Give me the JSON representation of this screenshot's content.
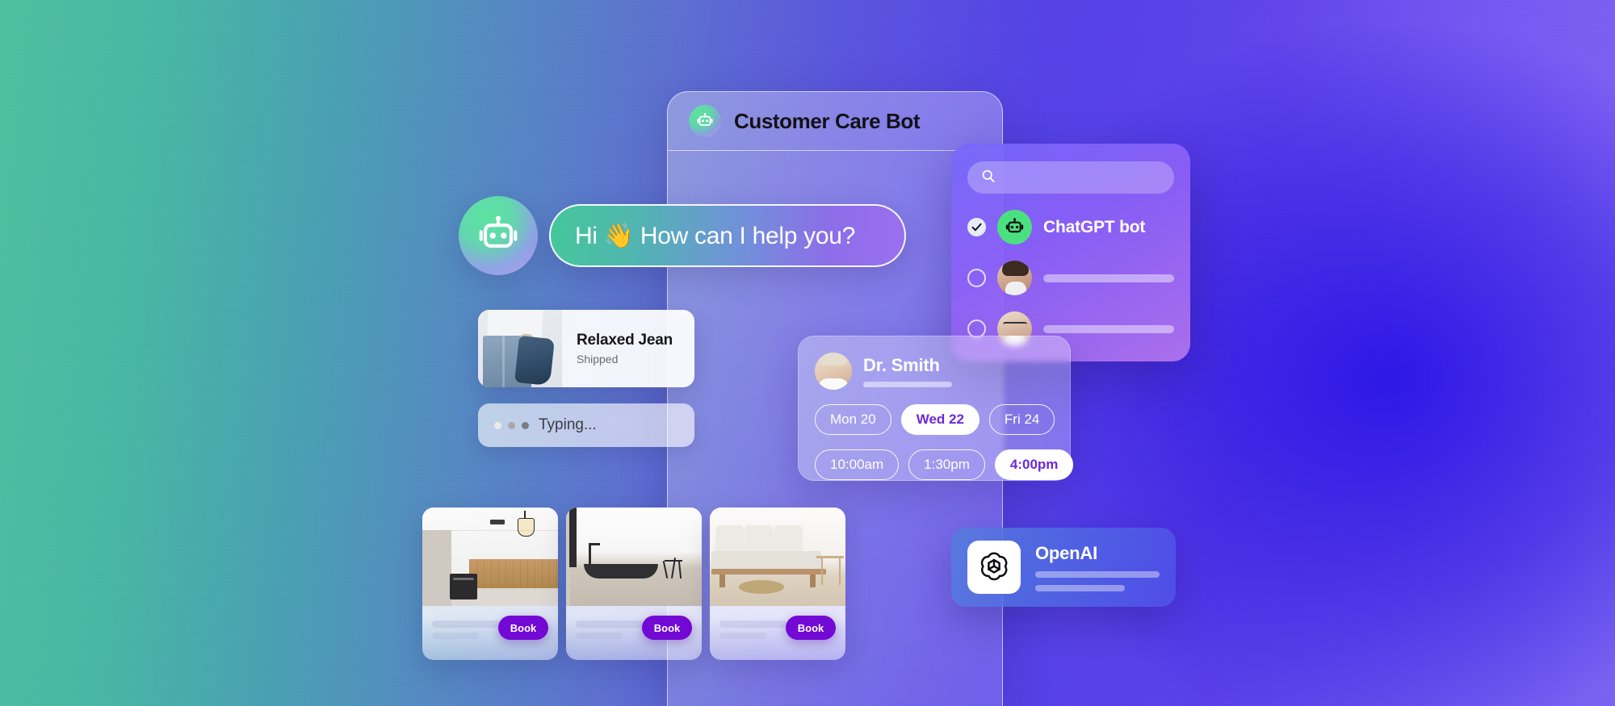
{
  "phone": {
    "title": "Customer Care Bot",
    "bot_icon": "robot-icon"
  },
  "greeting": {
    "avatar_icon": "robot-avatar-icon",
    "text": "Hi 👋 How can I help you?"
  },
  "product_card": {
    "name": "Relaxed Jean",
    "status": "Shipped",
    "thumb_icon": "jeans-photo"
  },
  "typing": {
    "label": "Typing..."
  },
  "bot_list": {
    "search_placeholder": "",
    "search_value": "",
    "search_icon": "search-icon",
    "items": [
      {
        "label": "ChatGPT bot",
        "selected": true,
        "avatar": "green-robot-icon"
      },
      {
        "label": "",
        "selected": false,
        "avatar": "woman-avatar"
      },
      {
        "label": "",
        "selected": false,
        "avatar": "man-avatar"
      }
    ]
  },
  "doctor_card": {
    "name": "Dr. Smith",
    "avatar": "doctor-avatar",
    "dates": [
      {
        "label": "Mon 20",
        "selected": false
      },
      {
        "label": "Wed 22",
        "selected": true
      },
      {
        "label": "Fri 24",
        "selected": false
      }
    ],
    "times": [
      {
        "label": "10:00am",
        "selected": false
      },
      {
        "label": "1:30pm",
        "selected": false
      },
      {
        "label": "4:00pm",
        "selected": true
      }
    ]
  },
  "openai_card": {
    "title": "OpenAI",
    "logo_icon": "openai-logo-icon"
  },
  "rooms": [
    {
      "image": "kitchen-photo",
      "book_label": "Book"
    },
    {
      "image": "bathroom-photo",
      "book_label": "Book"
    },
    {
      "image": "livingroom-photo",
      "book_label": "Book"
    }
  ],
  "colors": {
    "gradient_left": "#4fbe9f",
    "gradient_right": "#6a52ee",
    "accent_purple": "#7209d4",
    "chip_selected_text": "#6d28d9",
    "bot_green": "#4ae07f"
  }
}
